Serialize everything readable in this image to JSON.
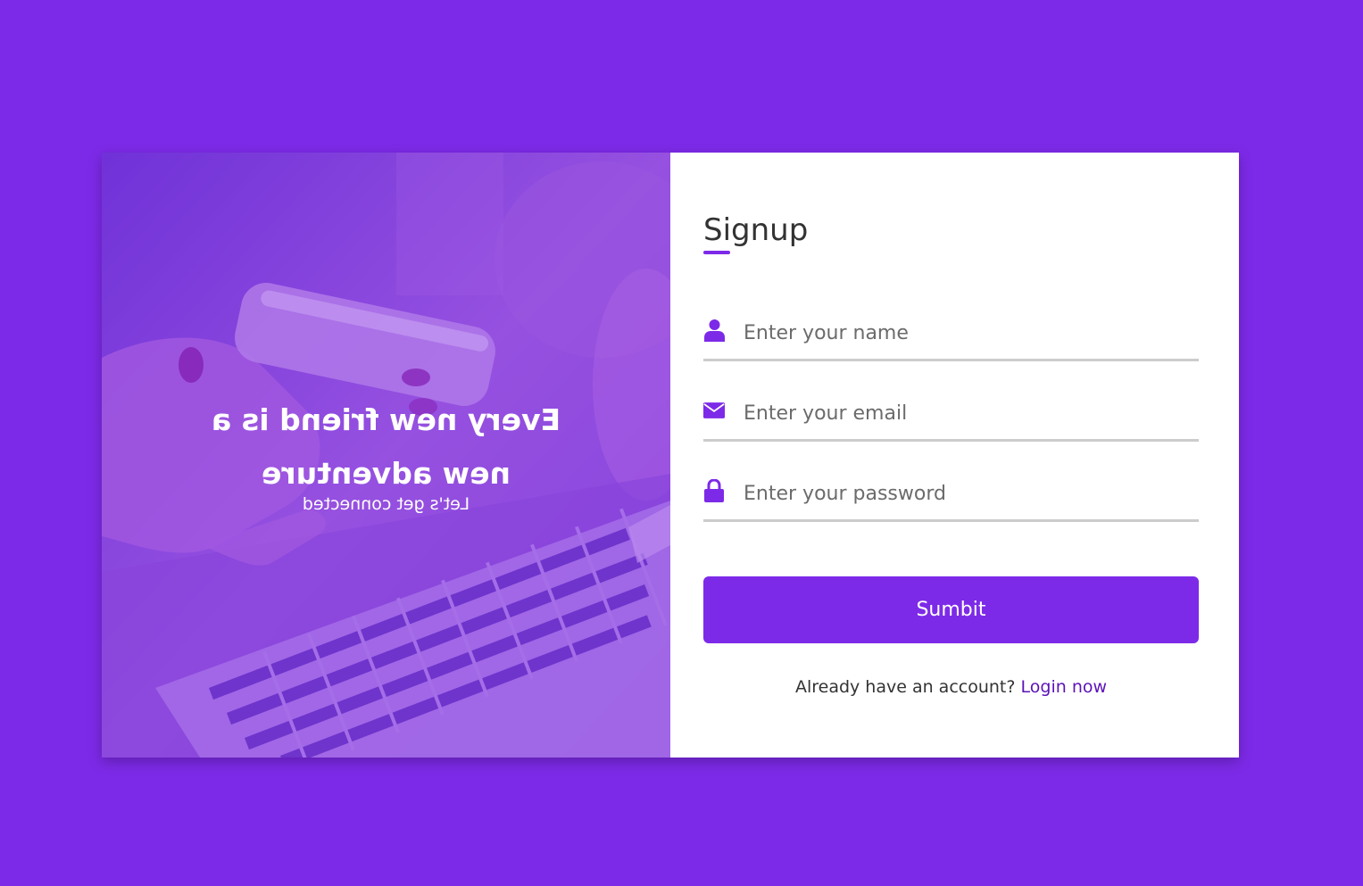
{
  "colors": {
    "background": "#7d2ae8",
    "accent": "#7d2ae8",
    "link": "#5b13b9",
    "field_border": "#cccccc"
  },
  "cover": {
    "title": "Every new friend is a new adventure",
    "subtitle": "Let's get connected"
  },
  "form": {
    "title": "Signup",
    "name_placeholder": "Enter your name",
    "name_icon": "user-icon",
    "email_placeholder": "Enter your email",
    "email_icon": "envelope-icon",
    "password_placeholder": "Enter your password",
    "password_icon": "lock-icon",
    "submit_label": "Sumbit",
    "login_prompt": "Already have an account?",
    "login_link": "Login now"
  }
}
